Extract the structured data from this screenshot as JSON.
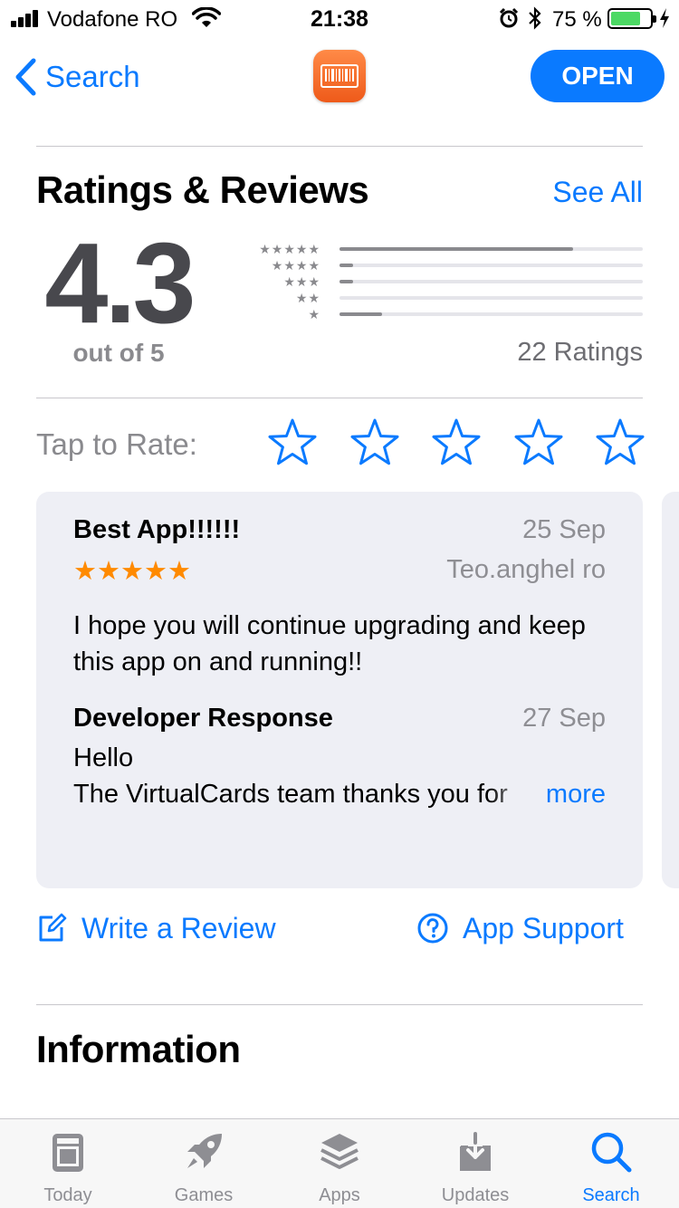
{
  "status_bar": {
    "carrier": "Vodafone RO",
    "time": "21:38",
    "battery_percent": "75 %",
    "battery_level": 0.75
  },
  "nav": {
    "back_label": "Search",
    "open_label": "OPEN",
    "app_icon": "barcode-icon"
  },
  "ratings": {
    "title": "Ratings & Reviews",
    "see_all": "See All",
    "average": "4.3",
    "out_of": "out of 5",
    "count": "22 Ratings",
    "histogram": [
      {
        "stars": "★★★★★",
        "fraction": 0.77
      },
      {
        "stars": "★★★★",
        "fraction": 0.045
      },
      {
        "stars": "★★★",
        "fraction": 0.045
      },
      {
        "stars": "★★",
        "fraction": 0.0
      },
      {
        "stars": "★",
        "fraction": 0.14
      }
    ]
  },
  "tap_to_rate": {
    "label": "Tap to Rate:",
    "star_count": 5
  },
  "review": {
    "title": "Best App!!!!!!",
    "date": "25 Sep",
    "stars": "★★★★★",
    "rating": 5,
    "author": "Teo.anghel ro",
    "body": "I hope you will continue upgrading and keep this app on and running!!",
    "developer_response": {
      "title": "Developer Response",
      "date": "27 Sep",
      "line1": "Hello",
      "line2": "The VirtualCards team thanks you for",
      "more": "more"
    }
  },
  "actions": {
    "write_review": "Write a Review",
    "app_support": "App Support"
  },
  "information": {
    "title": "Information"
  },
  "tabs": [
    {
      "label": "Today",
      "icon": "today-icon",
      "active": false
    },
    {
      "label": "Games",
      "icon": "rocket-icon",
      "active": false
    },
    {
      "label": "Apps",
      "icon": "layers-icon",
      "active": false
    },
    {
      "label": "Updates",
      "icon": "download-icon",
      "active": false
    },
    {
      "label": "Search",
      "icon": "search-icon",
      "active": true
    }
  ],
  "colors": {
    "accent": "#0a7aff",
    "review_star": "#ff8a00",
    "card_bg": "#eeeff5",
    "battery_green": "#4cd964"
  }
}
